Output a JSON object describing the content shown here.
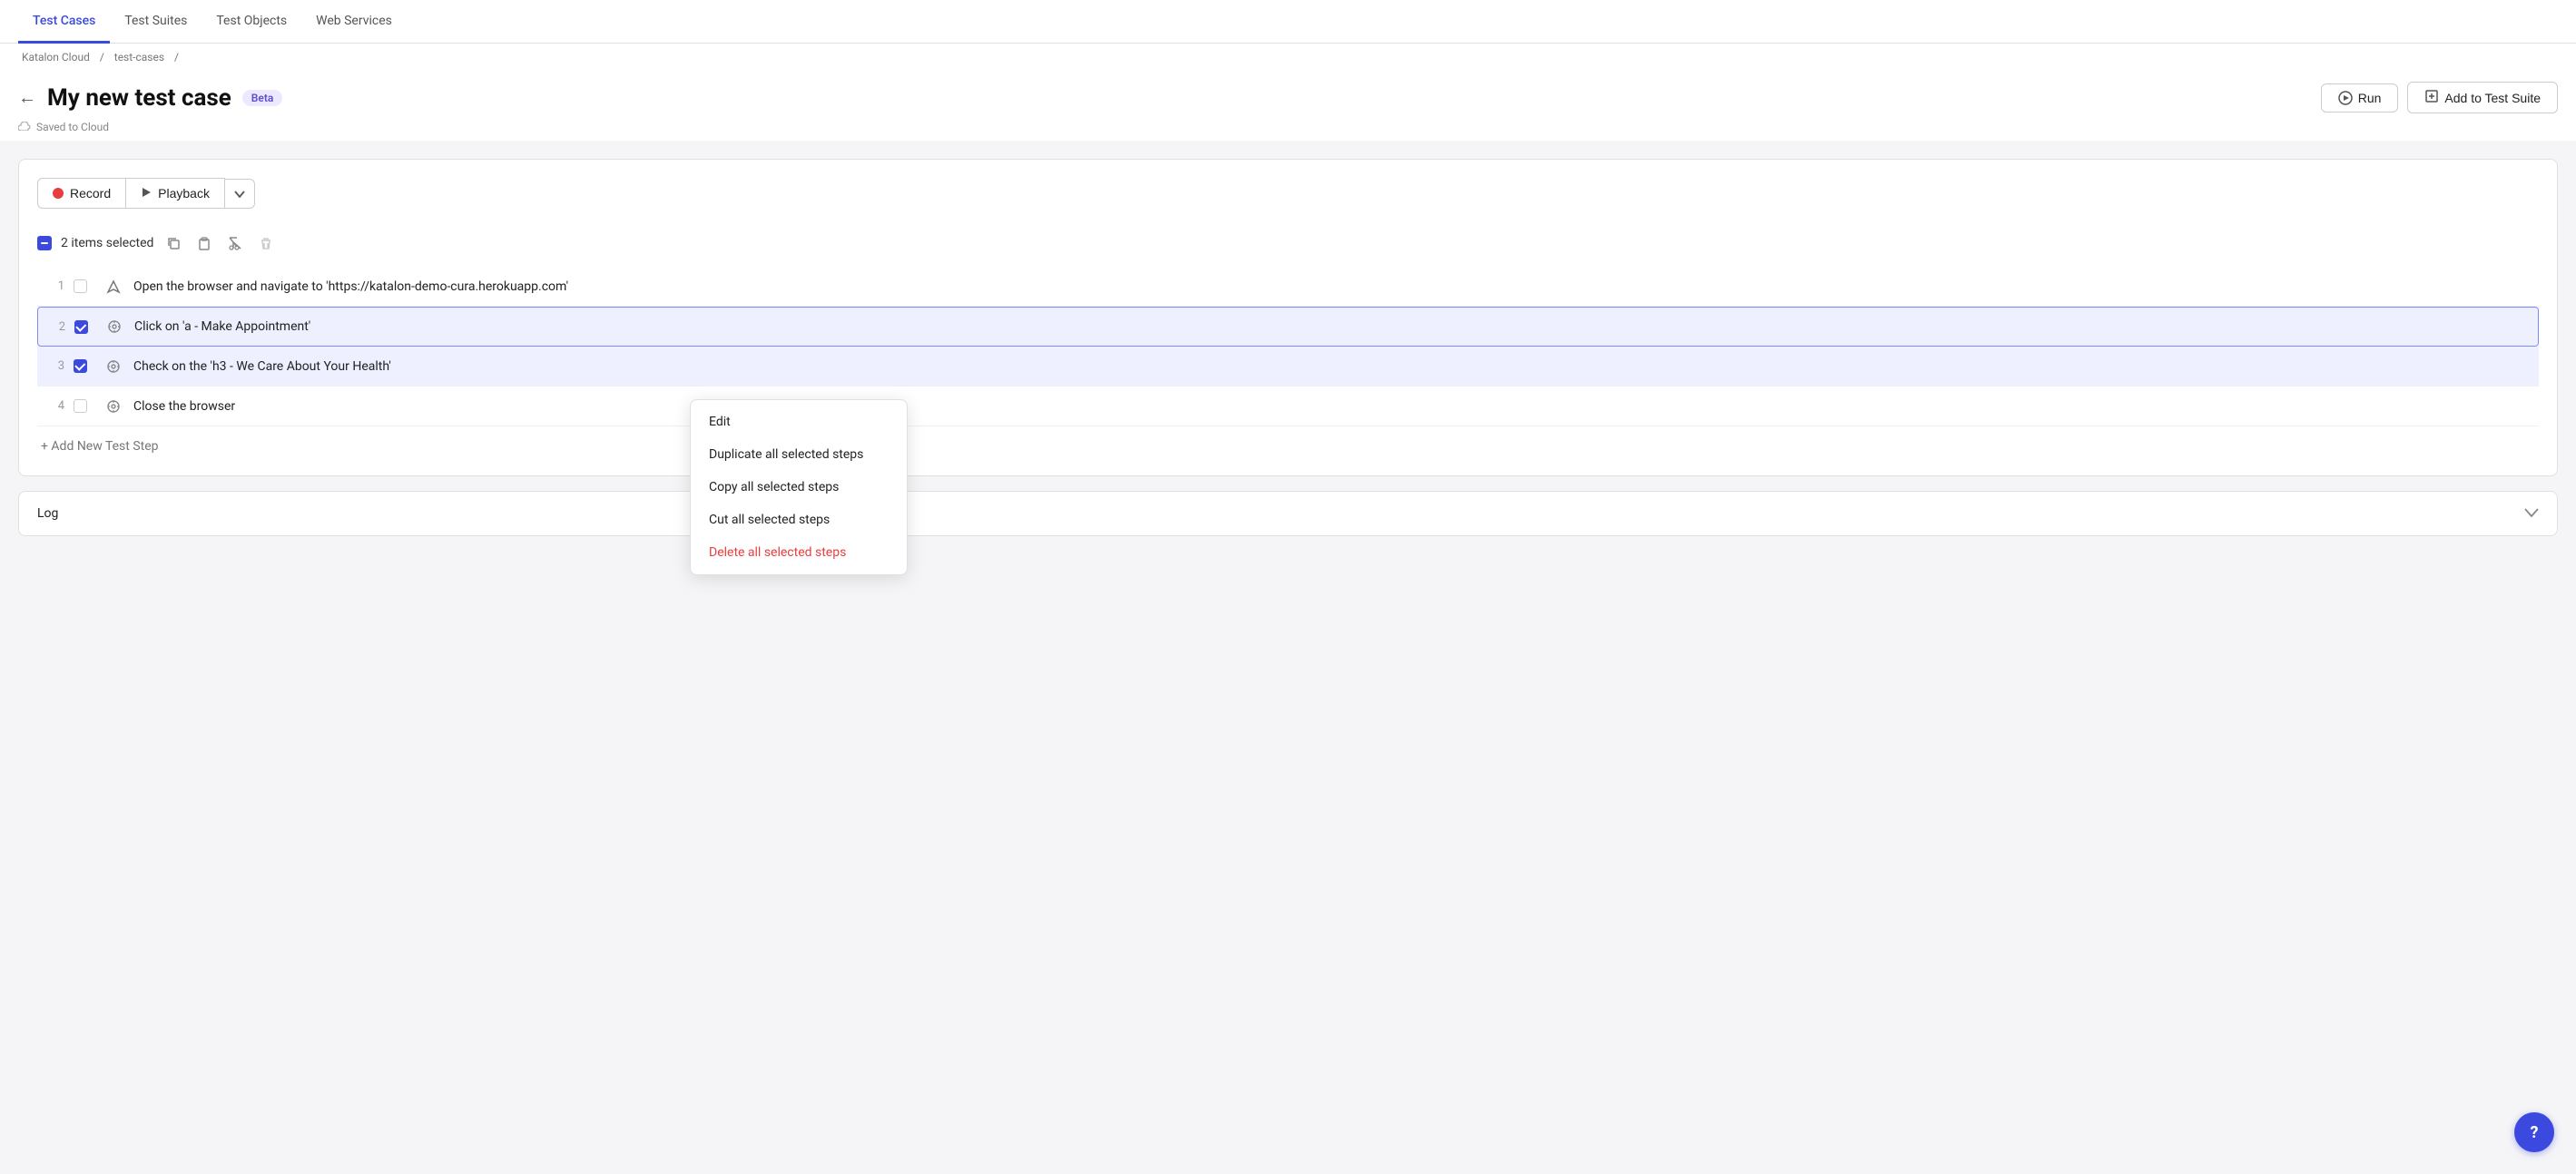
{
  "nav": {
    "items": [
      {
        "label": "Test Cases",
        "active": true
      },
      {
        "label": "Test Suites",
        "active": false
      },
      {
        "label": "Test Objects",
        "active": false
      },
      {
        "label": "Web Services",
        "active": false
      }
    ]
  },
  "breadcrumb": {
    "parts": [
      "Katalon Cloud",
      "test-cases"
    ]
  },
  "header": {
    "title": "My new test case",
    "badge": "Beta",
    "back_label": "←",
    "saved_label": "Saved to Cloud",
    "run_label": "Run",
    "add_suite_label": "Add to Test Suite"
  },
  "toolbar": {
    "record_label": "Record",
    "playback_label": "Playback"
  },
  "selection": {
    "count_label": "2 items selected"
  },
  "steps": [
    {
      "num": "1",
      "checked": false,
      "icon": "navigate",
      "desc": "Open the browser and navigate to 'https://katalon-demo-cura.herokuapp.com'"
    },
    {
      "num": "2",
      "checked": true,
      "icon": "target",
      "desc": "Click on 'a - Make Appointment'"
    },
    {
      "num": "3",
      "checked": true,
      "icon": "target",
      "desc": "Check on the 'h3 - We Care About Your Health'"
    },
    {
      "num": "4",
      "checked": false,
      "icon": "target",
      "desc": "Close the browser"
    }
  ],
  "add_step_label": "+ Add New Test Step",
  "log_label": "Log",
  "context_menu": {
    "items": [
      {
        "label": "Edit",
        "danger": false
      },
      {
        "label": "Duplicate all selected steps",
        "danger": false
      },
      {
        "label": "Copy all selected steps",
        "danger": false
      },
      {
        "label": "Cut all selected steps",
        "danger": false
      },
      {
        "label": "Delete all selected steps",
        "danger": true
      }
    ]
  }
}
